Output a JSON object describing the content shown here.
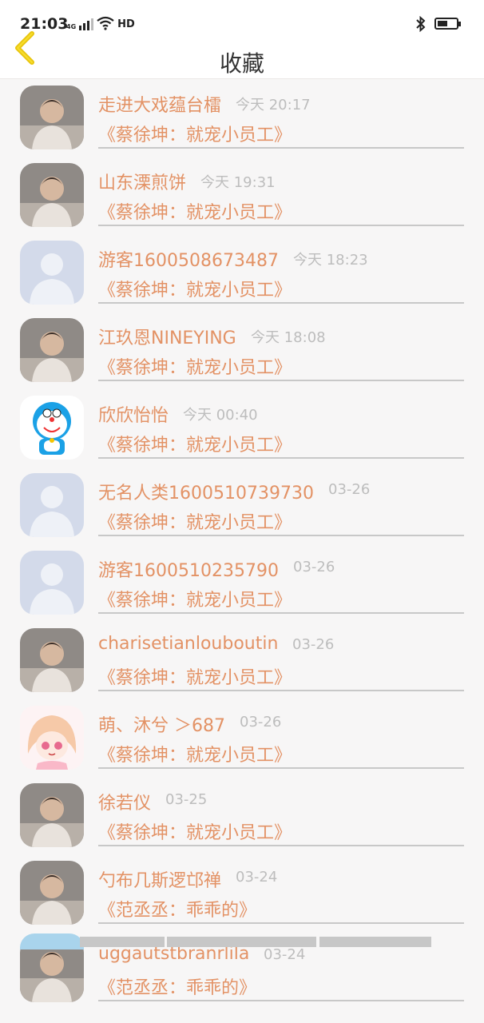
{
  "status_bar": {
    "time": "21:03",
    "network": "4G",
    "hd": "HD"
  },
  "header": {
    "title": "收藏",
    "back_icon": "chevron-left-icon"
  },
  "colors": {
    "accent": "#e39265",
    "back": "#f2d10e",
    "muted": "#bdbdbd"
  },
  "favorites": [
    {
      "name": "走进大戏蕴台檑",
      "time": "今天 20:17",
      "book": "《蔡徐坤：就宠小员工》",
      "avatar": "photo-avatar"
    },
    {
      "name": "山东溧煎饼",
      "time": "今天 19:31",
      "book": "《蔡徐坤：就宠小员工》",
      "avatar": "photo-avatar"
    },
    {
      "name": "游客1600508673487",
      "time": "今天 18:23",
      "book": "《蔡徐坤：就宠小员工》",
      "avatar": "default-avatar"
    },
    {
      "name": "江玖恩NINEYING",
      "time": "今天 18:08",
      "book": "《蔡徐坤：就宠小员工》",
      "avatar": "photo-avatar"
    },
    {
      "name": "欣欣怡怡",
      "time": "今天 00:40",
      "book": "《蔡徐坤：就宠小员工》",
      "avatar": "doraemon-avatar"
    },
    {
      "name": "无名人类1600510739730",
      "time": "03-26",
      "book": "《蔡徐坤：就宠小员工》",
      "avatar": "default-avatar"
    },
    {
      "name": "游客1600510235790",
      "time": "03-26",
      "book": "《蔡徐坤：就宠小员工》",
      "avatar": "default-avatar"
    },
    {
      "name": "charisetianlouboutin",
      "time": "03-26",
      "book": "《蔡徐坤：就宠小员工》",
      "avatar": "photo-avatar"
    },
    {
      "name": "萌、沐兮 ＞687",
      "time": "03-26",
      "book": "《蔡徐坤：就宠小员工》",
      "avatar": "anime-avatar"
    },
    {
      "name": "徐若仪",
      "time": "03-25",
      "book": "《蔡徐坤：就宠小员工》",
      "avatar": "photo-avatar"
    },
    {
      "name": "勺布几斯逻邙禅",
      "time": "03-24",
      "book": "《范丞丞：乖乖的》",
      "avatar": "photo-avatar"
    },
    {
      "name": "uggautstbranrlila",
      "time": "03-24",
      "book": "《范丞丞：乖乖的》",
      "avatar": "photo-avatar"
    }
  ]
}
